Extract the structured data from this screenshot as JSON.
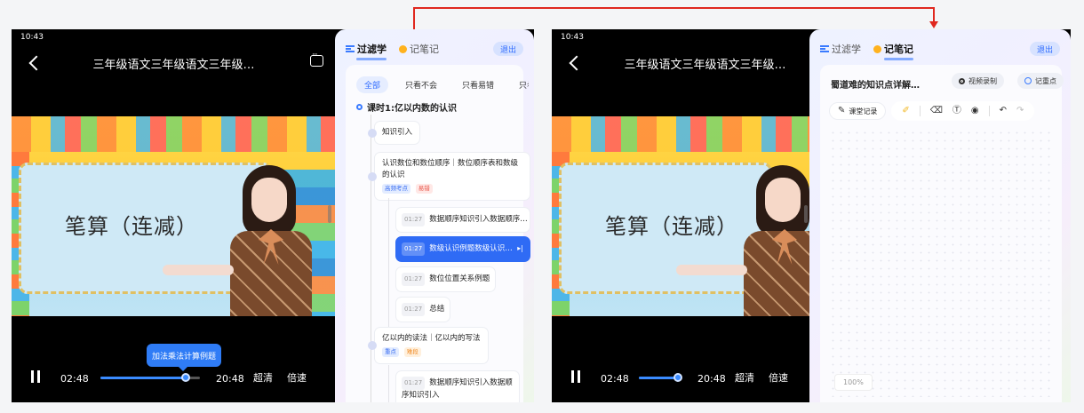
{
  "left": {
    "status_time": "10:43",
    "video_title": "三年级语文三年级语文三年级…",
    "board_text": "笔算（连减）",
    "player": {
      "current_time": "02:48",
      "total_time": "20:48",
      "quality": "超清",
      "speed": "倍速",
      "tooltip": "加法乘法计算例题",
      "progress": 0.86
    },
    "panel": {
      "tab_filter": "过滤学",
      "tab_notes": "记笔记",
      "exit": "退出",
      "chips": [
        "全部",
        "只看不会",
        "只看易错",
        "只看"
      ],
      "lesson_title": "课时1:亿以内数的认识",
      "nodes": {
        "intro": "知识引入",
        "section1": "认识数位和数位顺序｜数位顺序表和数级的认识",
        "section1_tags": [
          "高频考点",
          "易错"
        ],
        "sub1_time": "01:27",
        "sub1": "数据顺序知识引入数据顺序…",
        "sub2_time": "01:27",
        "sub2": "数级认识例题数级认识…",
        "sub3_time": "01:27",
        "sub3": "数位位置关系例题",
        "sub4_time": "01:27",
        "sub4": "总结",
        "section2": "亿以内的读法｜亿以内的写法",
        "section2_tags": [
          "重点",
          "难段"
        ],
        "sub5_time": "01:27",
        "sub5": "数据顺序知识引入数据顺序知识引入"
      }
    }
  },
  "right": {
    "status_time": "10:43",
    "video_title": "三年级语文三年级语文三年级…",
    "board_text": "笔算（连减）",
    "player": {
      "current_time": "02:48",
      "total_time": "20:48",
      "quality": "超清",
      "speed": "倍速",
      "progress": 0.92
    },
    "panel": {
      "tab_filter": "过滤学",
      "tab_notes": "记笔记",
      "exit": "退出",
      "notes_title": "蜀道难的知识点详解…",
      "video_record": "视频录制",
      "mark_point": "记重点",
      "class_record": "课堂记录",
      "zoom": "100%"
    }
  },
  "colors": {
    "accent": "#2f6bf5",
    "arrow": "#e0281f"
  }
}
